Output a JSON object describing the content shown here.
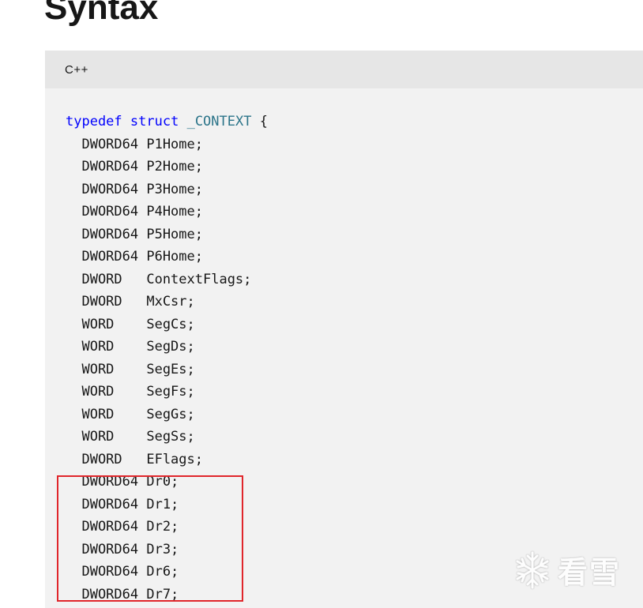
{
  "page": {
    "title": "Syntax"
  },
  "code_block": {
    "language": "C++",
    "lines": [
      {
        "tokens": [
          {
            "t": "typedef",
            "c": "kw"
          },
          {
            "t": " "
          },
          {
            "t": "struct",
            "c": "kw"
          },
          {
            "t": " "
          },
          {
            "t": "_CONTEXT",
            "c": "type-name"
          },
          {
            "t": " {"
          }
        ]
      },
      {
        "tokens": [
          {
            "t": "  DWORD64 P1Home;"
          }
        ]
      },
      {
        "tokens": [
          {
            "t": "  DWORD64 P2Home;"
          }
        ]
      },
      {
        "tokens": [
          {
            "t": "  DWORD64 P3Home;"
          }
        ]
      },
      {
        "tokens": [
          {
            "t": "  DWORD64 P4Home;"
          }
        ]
      },
      {
        "tokens": [
          {
            "t": "  DWORD64 P5Home;"
          }
        ]
      },
      {
        "tokens": [
          {
            "t": "  DWORD64 P6Home;"
          }
        ]
      },
      {
        "tokens": [
          {
            "t": "  DWORD   ContextFlags;"
          }
        ]
      },
      {
        "tokens": [
          {
            "t": "  DWORD   MxCsr;"
          }
        ]
      },
      {
        "tokens": [
          {
            "t": "  WORD    SegCs;"
          }
        ]
      },
      {
        "tokens": [
          {
            "t": "  WORD    SegDs;"
          }
        ]
      },
      {
        "tokens": [
          {
            "t": "  WORD    SegEs;"
          }
        ]
      },
      {
        "tokens": [
          {
            "t": "  WORD    SegFs;"
          }
        ]
      },
      {
        "tokens": [
          {
            "t": "  WORD    SegGs;"
          }
        ]
      },
      {
        "tokens": [
          {
            "t": "  WORD    SegSs;"
          }
        ]
      },
      {
        "tokens": [
          {
            "t": "  DWORD   EFlags;"
          }
        ]
      },
      {
        "tokens": [
          {
            "t": "  DWORD64 Dr0;"
          }
        ]
      },
      {
        "tokens": [
          {
            "t": "  DWORD64 Dr1;"
          }
        ]
      },
      {
        "tokens": [
          {
            "t": "  DWORD64 Dr2;"
          }
        ]
      },
      {
        "tokens": [
          {
            "t": "  DWORD64 Dr3;"
          }
        ]
      },
      {
        "tokens": [
          {
            "t": "  DWORD64 Dr6;"
          }
        ]
      },
      {
        "tokens": [
          {
            "t": "  DWORD64 Dr7;"
          }
        ]
      }
    ]
  },
  "colors": {
    "keyword": "#0101fd",
    "type_name": "#2b7489",
    "highlight_border": "#e0262b",
    "code_background": "#f2f2f2",
    "code_header_background": "#e6e6e6"
  },
  "watermark": {
    "icon": "snowflake-icon",
    "text": "看雪"
  }
}
